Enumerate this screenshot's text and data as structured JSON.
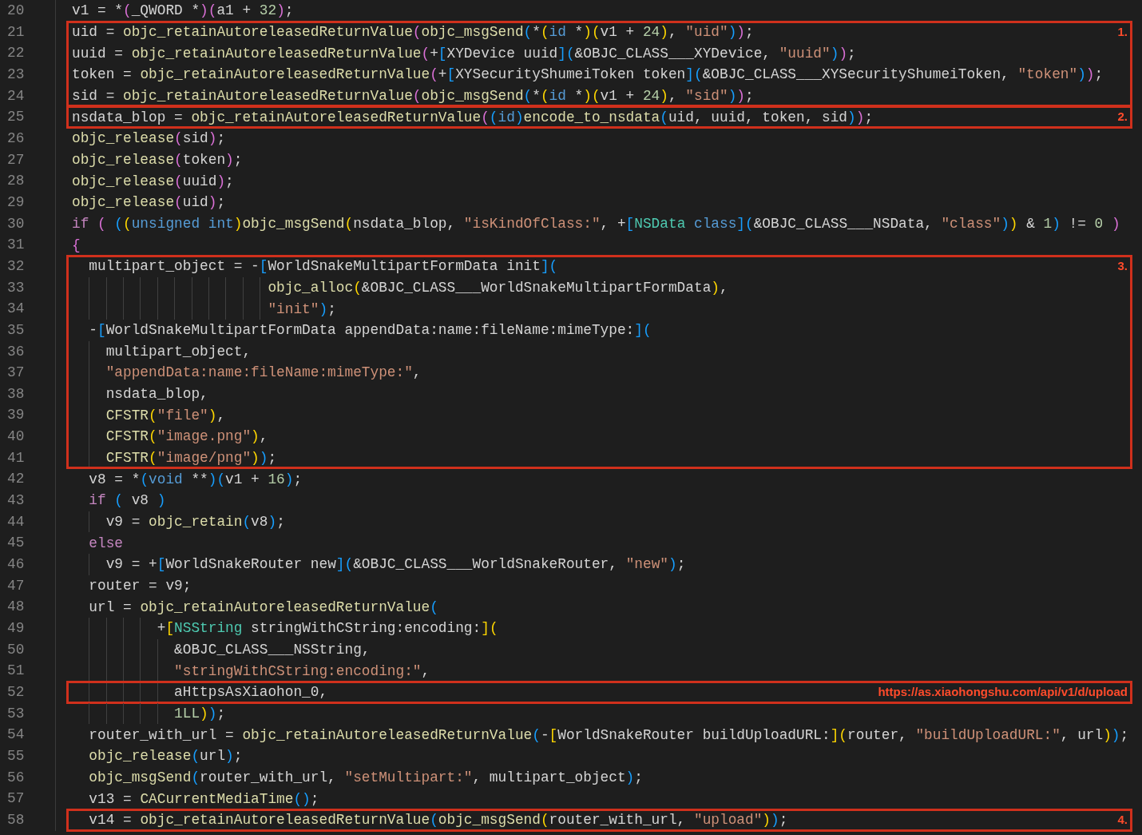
{
  "blocks": [
    {
      "kind": "plain",
      "lines": [
        {
          "number": "20",
          "tokens": [
            {
              "kind": "text",
              "text": "v1 = *"
            },
            {
              "kind": "paren2",
              "text": "("
            },
            {
              "kind": "text",
              "text": "_QWORD *"
            },
            {
              "kind": "paren2",
              "text": ")("
            },
            {
              "kind": "text",
              "text": "a1 + "
            },
            {
              "kind": "num",
              "text": "32"
            },
            {
              "kind": "paren2",
              "text": ")"
            },
            {
              "kind": "text",
              "text": ";"
            }
          ]
        }
      ]
    },
    {
      "kind": "highlight",
      "label": "1.",
      "lines": [
        {
          "number": "21",
          "tokens": [
            {
              "kind": "text",
              "text": "uid = "
            },
            {
              "kind": "fn",
              "text": "objc_retainAutoreleasedReturnValue"
            },
            {
              "kind": "paren2",
              "text": "("
            },
            {
              "kind": "fn",
              "text": "objc_msgSend"
            },
            {
              "kind": "paren3",
              "text": "("
            },
            {
              "kind": "text",
              "text": "*"
            },
            {
              "kind": "paren1",
              "text": "("
            },
            {
              "kind": "type",
              "text": "id"
            },
            {
              "kind": "text",
              "text": " *"
            },
            {
              "kind": "paren1",
              "text": ")("
            },
            {
              "kind": "text",
              "text": "v1 + "
            },
            {
              "kind": "num",
              "text": "24"
            },
            {
              "kind": "paren1",
              "text": ")"
            },
            {
              "kind": "text",
              "text": ", "
            },
            {
              "kind": "str",
              "text": "\"uid\""
            },
            {
              "kind": "paren3",
              "text": ")"
            },
            {
              "kind": "paren2",
              "text": ")"
            },
            {
              "kind": "text",
              "text": ";"
            }
          ]
        },
        {
          "number": "22",
          "tokens": [
            {
              "kind": "text",
              "text": "uuid = "
            },
            {
              "kind": "fn",
              "text": "objc_retainAutoreleasedReturnValue"
            },
            {
              "kind": "paren2",
              "text": "("
            },
            {
              "kind": "text",
              "text": "+"
            },
            {
              "kind": "paren3",
              "text": "["
            },
            {
              "kind": "text",
              "text": "XYDevice uuid"
            },
            {
              "kind": "paren3",
              "text": "]("
            },
            {
              "kind": "text",
              "text": "&OBJC_CLASS___XYDevice, "
            },
            {
              "kind": "str",
              "text": "\"uuid\""
            },
            {
              "kind": "paren3",
              "text": ")"
            },
            {
              "kind": "paren2",
              "text": ")"
            },
            {
              "kind": "text",
              "text": ";"
            }
          ]
        },
        {
          "number": "23",
          "tokens": [
            {
              "kind": "text",
              "text": "token = "
            },
            {
              "kind": "fn",
              "text": "objc_retainAutoreleasedReturnValue"
            },
            {
              "kind": "paren2",
              "text": "("
            },
            {
              "kind": "text",
              "text": "+"
            },
            {
              "kind": "paren3",
              "text": "["
            },
            {
              "kind": "text",
              "text": "XYSecurityShumeiToken token"
            },
            {
              "kind": "paren3",
              "text": "]("
            },
            {
              "kind": "text",
              "text": "&OBJC_CLASS___XYSecurityShumeiToken, "
            },
            {
              "kind": "str",
              "text": "\"token\""
            },
            {
              "kind": "paren3",
              "text": ")"
            },
            {
              "kind": "paren2",
              "text": ")"
            },
            {
              "kind": "text",
              "text": ";"
            }
          ]
        },
        {
          "number": "24",
          "tokens": [
            {
              "kind": "text",
              "text": "sid = "
            },
            {
              "kind": "fn",
              "text": "objc_retainAutoreleasedReturnValue"
            },
            {
              "kind": "paren2",
              "text": "("
            },
            {
              "kind": "fn",
              "text": "objc_msgSend"
            },
            {
              "kind": "paren3",
              "text": "("
            },
            {
              "kind": "text",
              "text": "*"
            },
            {
              "kind": "paren1",
              "text": "("
            },
            {
              "kind": "type",
              "text": "id"
            },
            {
              "kind": "text",
              "text": " *"
            },
            {
              "kind": "paren1",
              "text": ")("
            },
            {
              "kind": "text",
              "text": "v1 + "
            },
            {
              "kind": "num",
              "text": "24"
            },
            {
              "kind": "paren1",
              "text": ")"
            },
            {
              "kind": "text",
              "text": ", "
            },
            {
              "kind": "str",
              "text": "\"sid\""
            },
            {
              "kind": "paren3",
              "text": ")"
            },
            {
              "kind": "paren2",
              "text": ")"
            },
            {
              "kind": "text",
              "text": ";"
            }
          ]
        }
      ]
    },
    {
      "kind": "highlight",
      "label": "2.",
      "lines": [
        {
          "number": "25",
          "tokens": [
            {
              "kind": "text",
              "text": "nsdata_blop = "
            },
            {
              "kind": "fn",
              "text": "objc_retainAutoreleasedReturnValue"
            },
            {
              "kind": "paren2",
              "text": "("
            },
            {
              "kind": "paren3",
              "text": "("
            },
            {
              "kind": "type",
              "text": "id"
            },
            {
              "kind": "paren3",
              "text": ")"
            },
            {
              "kind": "fn",
              "text": "encode_to_nsdata"
            },
            {
              "kind": "paren3",
              "text": "("
            },
            {
              "kind": "text",
              "text": "uid, uuid, token, sid"
            },
            {
              "kind": "paren3",
              "text": ")"
            },
            {
              "kind": "paren2",
              "text": ")"
            },
            {
              "kind": "text",
              "text": ";"
            }
          ]
        }
      ]
    },
    {
      "kind": "plain",
      "lines": [
        {
          "number": "26",
          "tokens": [
            {
              "kind": "fn",
              "text": "objc_release"
            },
            {
              "kind": "paren2",
              "text": "("
            },
            {
              "kind": "text",
              "text": "sid"
            },
            {
              "kind": "paren2",
              "text": ")"
            },
            {
              "kind": "text",
              "text": ";"
            }
          ]
        },
        {
          "number": "27",
          "tokens": [
            {
              "kind": "fn",
              "text": "objc_release"
            },
            {
              "kind": "paren2",
              "text": "("
            },
            {
              "kind": "text",
              "text": "token"
            },
            {
              "kind": "paren2",
              "text": ")"
            },
            {
              "kind": "text",
              "text": ";"
            }
          ]
        },
        {
          "number": "28",
          "tokens": [
            {
              "kind": "fn",
              "text": "objc_release"
            },
            {
              "kind": "paren2",
              "text": "("
            },
            {
              "kind": "text",
              "text": "uuid"
            },
            {
              "kind": "paren2",
              "text": ")"
            },
            {
              "kind": "text",
              "text": ";"
            }
          ]
        },
        {
          "number": "29",
          "tokens": [
            {
              "kind": "fn",
              "text": "objc_release"
            },
            {
              "kind": "paren2",
              "text": "("
            },
            {
              "kind": "text",
              "text": "uid"
            },
            {
              "kind": "paren2",
              "text": ")"
            },
            {
              "kind": "text",
              "text": ";"
            }
          ]
        },
        {
          "number": "30",
          "tokens": [
            {
              "kind": "kw",
              "text": "if"
            },
            {
              "kind": "paren2",
              "text": " ( "
            },
            {
              "kind": "paren3",
              "text": "("
            },
            {
              "kind": "paren1",
              "text": "("
            },
            {
              "kind": "type",
              "text": "unsigned int"
            },
            {
              "kind": "paren1",
              "text": ")"
            },
            {
              "kind": "fn",
              "text": "objc_msgSend"
            },
            {
              "kind": "paren1",
              "text": "("
            },
            {
              "kind": "text",
              "text": "nsdata_blop, "
            },
            {
              "kind": "str",
              "text": "\"isKindOfClass:\""
            },
            {
              "kind": "text",
              "text": ", +"
            },
            {
              "kind": "paren3",
              "text": "["
            },
            {
              "kind": "class",
              "text": "NSData"
            },
            {
              "kind": "type",
              "text": " class"
            },
            {
              "kind": "paren3",
              "text": "]("
            },
            {
              "kind": "text",
              "text": "&OBJC_CLASS___NSData, "
            },
            {
              "kind": "str",
              "text": "\"class\""
            },
            {
              "kind": "paren3",
              "text": ")"
            },
            {
              "kind": "paren1",
              "text": ")"
            },
            {
              "kind": "text",
              "text": " & "
            },
            {
              "kind": "num",
              "text": "1"
            },
            {
              "kind": "paren3",
              "text": ")"
            },
            {
              "kind": "text",
              "text": " != "
            },
            {
              "kind": "num",
              "text": "0"
            },
            {
              "kind": "paren2",
              "text": " )"
            }
          ]
        },
        {
          "number": "31",
          "tokens": [
            {
              "kind": "paren2",
              "text": "{"
            }
          ]
        }
      ]
    },
    {
      "kind": "highlight",
      "label": "3.",
      "lines": [
        {
          "number": "32",
          "tokens": [
            {
              "kind": "text",
              "text": "  multipart_object = -"
            },
            {
              "kind": "paren3",
              "text": "["
            },
            {
              "kind": "text",
              "text": "WorldSnakeMultipartFormData init"
            },
            {
              "kind": "paren3",
              "text": "]("
            }
          ]
        },
        {
          "number": "33",
          "tokens": [
            {
              "kind": "fn",
              "text": "                       objc_alloc"
            },
            {
              "kind": "paren1",
              "text": "("
            },
            {
              "kind": "text",
              "text": "&OBJC_CLASS___WorldSnakeMultipartFormData"
            },
            {
              "kind": "paren1",
              "text": ")"
            },
            {
              "kind": "text",
              "text": ","
            }
          ]
        },
        {
          "number": "34",
          "tokens": [
            {
              "kind": "str",
              "text": "                       \"init\""
            },
            {
              "kind": "paren3",
              "text": ")"
            },
            {
              "kind": "text",
              "text": ";"
            }
          ]
        },
        {
          "number": "35",
          "tokens": [
            {
              "kind": "text",
              "text": "  -"
            },
            {
              "kind": "paren3",
              "text": "["
            },
            {
              "kind": "text",
              "text": "WorldSnakeMultipartFormData appendData:name:fileName:mimeType:"
            },
            {
              "kind": "paren3",
              "text": "]("
            }
          ]
        },
        {
          "number": "36",
          "tokens": [
            {
              "kind": "text",
              "text": "    multipart_object,"
            }
          ]
        },
        {
          "number": "37",
          "tokens": [
            {
              "kind": "str",
              "text": "    \"appendData:name:fileName:mimeType:\""
            },
            {
              "kind": "text",
              "text": ","
            }
          ]
        },
        {
          "number": "38",
          "tokens": [
            {
              "kind": "text",
              "text": "    nsdata_blop,"
            }
          ]
        },
        {
          "number": "39",
          "tokens": [
            {
              "kind": "fn",
              "text": "    CFSTR"
            },
            {
              "kind": "paren1",
              "text": "("
            },
            {
              "kind": "str",
              "text": "\"file\""
            },
            {
              "kind": "paren1",
              "text": ")"
            },
            {
              "kind": "text",
              "text": ","
            }
          ]
        },
        {
          "number": "40",
          "tokens": [
            {
              "kind": "fn",
              "text": "    CFSTR"
            },
            {
              "kind": "paren1",
              "text": "("
            },
            {
              "kind": "str",
              "text": "\"image.png\""
            },
            {
              "kind": "paren1",
              "text": ")"
            },
            {
              "kind": "text",
              "text": ","
            }
          ]
        },
        {
          "number": "41",
          "tokens": [
            {
              "kind": "fn",
              "text": "    CFSTR"
            },
            {
              "kind": "paren1",
              "text": "("
            },
            {
              "kind": "str",
              "text": "\"image/png\""
            },
            {
              "kind": "paren1",
              "text": ")"
            },
            {
              "kind": "paren3",
              "text": ")"
            },
            {
              "kind": "text",
              "text": ";"
            }
          ]
        }
      ]
    },
    {
      "kind": "plain",
      "lines": [
        {
          "number": "42",
          "tokens": [
            {
              "kind": "text",
              "text": "  v8 = *"
            },
            {
              "kind": "paren3",
              "text": "("
            },
            {
              "kind": "type",
              "text": "void"
            },
            {
              "kind": "text",
              "text": " **"
            },
            {
              "kind": "paren3",
              "text": ")("
            },
            {
              "kind": "text",
              "text": "v1 + "
            },
            {
              "kind": "num",
              "text": "16"
            },
            {
              "kind": "paren3",
              "text": ")"
            },
            {
              "kind": "text",
              "text": ";"
            }
          ]
        },
        {
          "number": "43",
          "tokens": [
            {
              "kind": "kw",
              "text": "  if"
            },
            {
              "kind": "paren3",
              "text": " ("
            },
            {
              "kind": "text",
              "text": " v8 "
            },
            {
              "kind": "paren3",
              "text": ")"
            }
          ]
        },
        {
          "number": "44",
          "tokens": [
            {
              "kind": "text",
              "text": "    v9 = "
            },
            {
              "kind": "fn",
              "text": "objc_retain"
            },
            {
              "kind": "paren3",
              "text": "("
            },
            {
              "kind": "text",
              "text": "v8"
            },
            {
              "kind": "paren3",
              "text": ")"
            },
            {
              "kind": "text",
              "text": ";"
            }
          ]
        },
        {
          "number": "45",
          "tokens": [
            {
              "kind": "kw",
              "text": "  else"
            }
          ]
        },
        {
          "number": "46",
          "tokens": [
            {
              "kind": "text",
              "text": "    v9 = +"
            },
            {
              "kind": "paren3",
              "text": "["
            },
            {
              "kind": "text",
              "text": "WorldSnakeRouter new"
            },
            {
              "kind": "paren3",
              "text": "]("
            },
            {
              "kind": "text",
              "text": "&OBJC_CLASS___WorldSnakeRouter, "
            },
            {
              "kind": "str",
              "text": "\"new\""
            },
            {
              "kind": "paren3",
              "text": ")"
            },
            {
              "kind": "text",
              "text": ";"
            }
          ]
        },
        {
          "number": "47",
          "tokens": [
            {
              "kind": "text",
              "text": "  router = v9;"
            }
          ]
        },
        {
          "number": "48",
          "tokens": [
            {
              "kind": "text",
              "text": "  url = "
            },
            {
              "kind": "fn",
              "text": "objc_retainAutoreleasedReturnValue"
            },
            {
              "kind": "paren3",
              "text": "("
            }
          ]
        },
        {
          "number": "49",
          "tokens": [
            {
              "kind": "text",
              "text": "          +"
            },
            {
              "kind": "paren1",
              "text": "["
            },
            {
              "kind": "class",
              "text": "NSString"
            },
            {
              "kind": "text",
              "text": " stringWithCString:encoding:"
            },
            {
              "kind": "paren1",
              "text": "]("
            }
          ]
        },
        {
          "number": "50",
          "tokens": [
            {
              "kind": "text",
              "text": "            &OBJC_CLASS___NSString,"
            }
          ]
        },
        {
          "number": "51",
          "tokens": [
            {
              "kind": "str",
              "text": "            \"stringWithCString:encoding:\""
            },
            {
              "kind": "text",
              "text": ","
            }
          ]
        }
      ]
    },
    {
      "kind": "highlight",
      "label": "https://as.xiaohongshu.com/api/v1/d/upload",
      "lines": [
        {
          "number": "52",
          "tokens": [
            {
              "kind": "text",
              "text": "            aHttpsAsXiaohon_0,"
            }
          ]
        }
      ]
    },
    {
      "kind": "plain",
      "lines": [
        {
          "number": "53",
          "tokens": [
            {
              "kind": "num",
              "text": "            1LL"
            },
            {
              "kind": "paren1",
              "text": ")"
            },
            {
              "kind": "paren3",
              "text": ")"
            },
            {
              "kind": "text",
              "text": ";"
            }
          ]
        },
        {
          "number": "54",
          "tokens": [
            {
              "kind": "text",
              "text": "  router_with_url = "
            },
            {
              "kind": "fn",
              "text": "objc_retainAutoreleasedReturnValue"
            },
            {
              "kind": "paren3",
              "text": "("
            },
            {
              "kind": "text",
              "text": "-"
            },
            {
              "kind": "paren1",
              "text": "["
            },
            {
              "kind": "text",
              "text": "WorldSnakeRouter buildUploadURL:"
            },
            {
              "kind": "paren1",
              "text": "]("
            },
            {
              "kind": "text",
              "text": "router, "
            },
            {
              "kind": "str",
              "text": "\"buildUploadURL:\""
            },
            {
              "kind": "text",
              "text": ", url"
            },
            {
              "kind": "paren1",
              "text": ")"
            },
            {
              "kind": "paren3",
              "text": ")"
            },
            {
              "kind": "text",
              "text": ";"
            }
          ]
        },
        {
          "number": "55",
          "tokens": [
            {
              "kind": "fn",
              "text": "  objc_release"
            },
            {
              "kind": "paren3",
              "text": "("
            },
            {
              "kind": "text",
              "text": "url"
            },
            {
              "kind": "paren3",
              "text": ")"
            },
            {
              "kind": "text",
              "text": ";"
            }
          ]
        },
        {
          "number": "56",
          "tokens": [
            {
              "kind": "fn",
              "text": "  objc_msgSend"
            },
            {
              "kind": "paren3",
              "text": "("
            },
            {
              "kind": "text",
              "text": "router_with_url, "
            },
            {
              "kind": "str",
              "text": "\"setMultipart:\""
            },
            {
              "kind": "text",
              "text": ", multipart_object"
            },
            {
              "kind": "paren3",
              "text": ")"
            },
            {
              "kind": "text",
              "text": ";"
            }
          ]
        },
        {
          "number": "57",
          "tokens": [
            {
              "kind": "text",
              "text": "  v13 = "
            },
            {
              "kind": "fn",
              "text": "CACurrentMediaTime"
            },
            {
              "kind": "paren3",
              "text": "()"
            },
            {
              "kind": "text",
              "text": ";"
            }
          ]
        }
      ]
    },
    {
      "kind": "highlight",
      "label": "4.",
      "lines": [
        {
          "number": "58",
          "tokens": [
            {
              "kind": "text",
              "text": "  v14 = "
            },
            {
              "kind": "fn",
              "text": "objc_retainAutoreleasedReturnValue"
            },
            {
              "kind": "paren3",
              "text": "("
            },
            {
              "kind": "fn",
              "text": "objc_msgSend"
            },
            {
              "kind": "paren1",
              "text": "("
            },
            {
              "kind": "text",
              "text": "router_with_url, "
            },
            {
              "kind": "str",
              "text": "\"upload\""
            },
            {
              "kind": "paren1",
              "text": ")"
            },
            {
              "kind": "paren3",
              "text": ")"
            },
            {
              "kind": "text",
              "text": ";"
            }
          ]
        }
      ]
    }
  ]
}
